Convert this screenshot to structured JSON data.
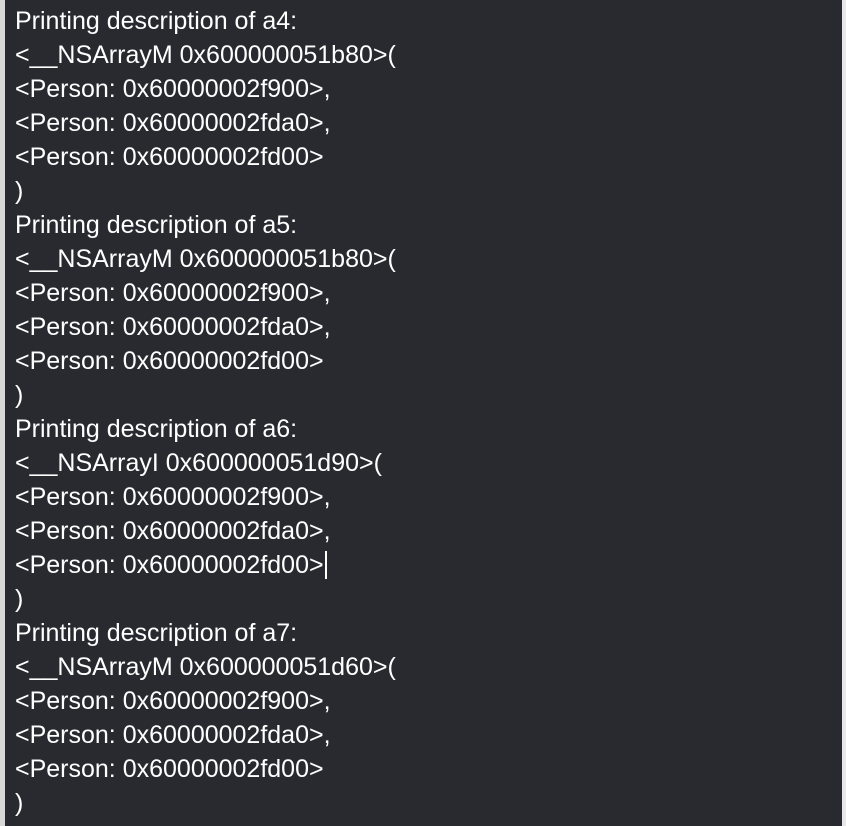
{
  "console": {
    "lines": [
      "Printing description of a4:",
      "<__NSArrayM 0x600000051b80>(",
      "<Person: 0x60000002f900>,",
      "<Person: 0x60000002fda0>,",
      "<Person: 0x60000002fd00>",
      ")",
      "Printing description of a5:",
      "<__NSArrayM 0x600000051b80>(",
      "<Person: 0x60000002f900>,",
      "<Person: 0x60000002fda0>,",
      "<Person: 0x60000002fd00>",
      ")",
      "Printing description of a6:",
      "<__NSArrayI 0x600000051d90>(",
      "<Person: 0x60000002f900>,",
      "<Person: 0x60000002fda0>,",
      "<Person: 0x60000002fd00>",
      ")",
      "Printing description of a7:",
      "<__NSArrayM 0x600000051d60>(",
      "<Person: 0x60000002f900>,",
      "<Person: 0x60000002fda0>,",
      "<Person: 0x60000002fd00>",
      ")"
    ]
  }
}
